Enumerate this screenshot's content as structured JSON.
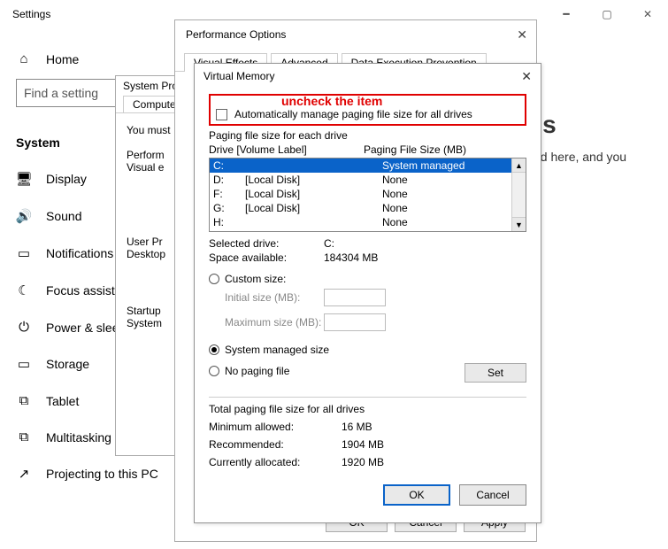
{
  "settings": {
    "window_title": "Settings",
    "search_placeholder": "Find a setting",
    "home_label": "Home",
    "nav": [
      {
        "label": "System",
        "icon": ""
      },
      {
        "label": "Display",
        "icon": "🖥"
      },
      {
        "label": "Sound",
        "icon": "🔊"
      },
      {
        "label": "Notifications",
        "icon": "▭"
      },
      {
        "label": "Focus assist",
        "icon": "☾"
      },
      {
        "label": "Power & slee",
        "icon": "⏻"
      },
      {
        "label": "Storage",
        "icon": "▭"
      },
      {
        "label": "Tablet",
        "icon": "⧉"
      },
      {
        "label": "Multitasking",
        "icon": "⧉"
      },
      {
        "label": "Projecting to this PC",
        "icon": "↗"
      }
    ],
    "body_heading_tail": "gs",
    "body_text_tail": "ved here, and you"
  },
  "sysprop": {
    "title": "System Pro",
    "tab": "Computer N",
    "line1": "You must",
    "perf_label": "Perform",
    "visual_label": "Visual e",
    "userprof_label": "User Pr",
    "desktop_label": "Desktop",
    "startup_label": "Startup",
    "system_label": "System"
  },
  "perf": {
    "title": "Performance Options",
    "tabs": [
      "Visual Effects",
      "Advanced",
      "Data Execution Prevention"
    ],
    "buttons": {
      "ok": "OK",
      "cancel": "Cancel",
      "apply": "Apply"
    }
  },
  "vm": {
    "title": "Virtual Memory",
    "annotation": "uncheck the item",
    "auto_label": "Automatically manage paging file size for all drives",
    "section_label": "Paging file size for each drive",
    "head_drive": "Drive  [Volume Label]",
    "head_size": "Paging File Size (MB)",
    "drives": [
      {
        "letter": "C:",
        "label": "",
        "size": "System managed",
        "selected": true
      },
      {
        "letter": "D:",
        "label": "[Local Disk]",
        "size": "None"
      },
      {
        "letter": "F:",
        "label": "[Local Disk]",
        "size": "None"
      },
      {
        "letter": "G:",
        "label": "[Local Disk]",
        "size": "None"
      },
      {
        "letter": "H:",
        "label": "",
        "size": "None"
      }
    ],
    "selected_drive_label": "Selected drive:",
    "selected_drive_value": "C:",
    "space_label": "Space available:",
    "space_value": "184304 MB",
    "custom_label": "Custom size:",
    "initial_label": "Initial size (MB):",
    "max_label": "Maximum size (MB):",
    "sysmanaged_label": "System managed size",
    "nopaging_label": "No paging file",
    "set_label": "Set",
    "totals_label": "Total paging file size for all drives",
    "min_label": "Minimum allowed:",
    "min_value": "16 MB",
    "rec_label": "Recommended:",
    "rec_value": "1904 MB",
    "cur_label": "Currently allocated:",
    "cur_value": "1920 MB",
    "ok": "OK",
    "cancel": "Cancel"
  }
}
